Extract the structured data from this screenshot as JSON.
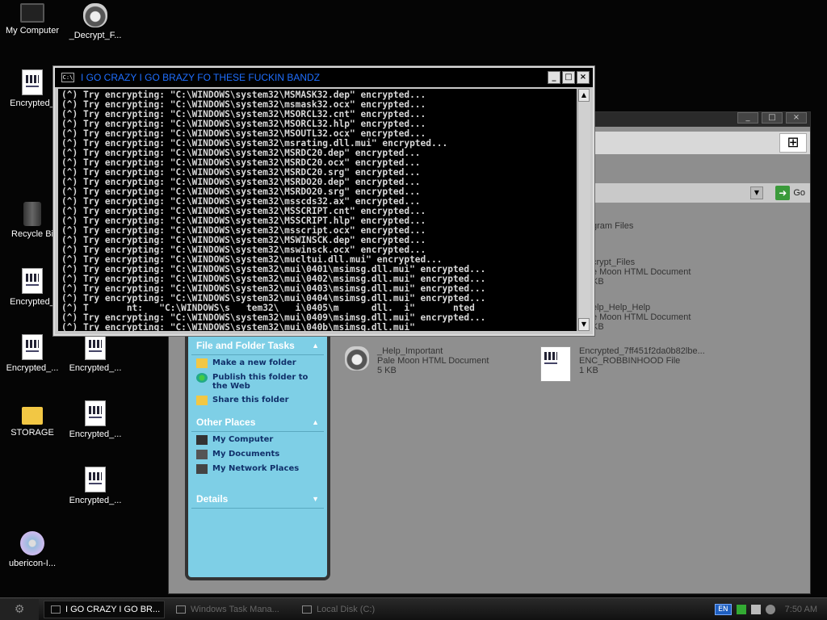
{
  "desktop": {
    "icons": [
      {
        "label": "My Computer",
        "icon": "monitor-icon"
      },
      {
        "label": "_Decrypt_F...",
        "icon": "raccoon-icon"
      },
      {
        "label": "Encrypted_",
        "icon": "document-icon"
      },
      {
        "label": "Recycle Bi",
        "icon": "recycle-bin-icon"
      },
      {
        "label": "Encrypted_",
        "icon": "document-icon"
      },
      {
        "label": "Encrypted_...",
        "icon": "document-icon"
      },
      {
        "label": "Encrypted_...",
        "icon": "document-icon"
      },
      {
        "label": "STORAGE",
        "icon": "folder-icon"
      },
      {
        "label": "Encrypted_...",
        "icon": "document-icon"
      },
      {
        "label": "Encrypted_...",
        "icon": "document-icon"
      },
      {
        "label": "ubericon-I...",
        "icon": "cd-icon"
      }
    ]
  },
  "explorer": {
    "go_label": "Go",
    "task_sections": [
      {
        "title": "File and Folder Tasks",
        "items": [
          {
            "label": "Make a new folder",
            "icon": "folder-icon"
          },
          {
            "label": "Publish this folder to the Web",
            "icon": "globe-icon"
          },
          {
            "label": "Share this folder",
            "icon": "share-folder-icon"
          }
        ]
      },
      {
        "title": "Other Places",
        "items": [
          {
            "label": "My Computer",
            "icon": "computer-icon"
          },
          {
            "label": "My Documents",
            "icon": "documents-icon"
          },
          {
            "label": "My Network Places",
            "icon": "network-icon"
          }
        ]
      },
      {
        "title": "Details",
        "items": []
      }
    ],
    "files": [
      {
        "name": "gram Files",
        "type": "",
        "size": ""
      },
      {
        "name": "crypt_Files",
        "type": "e Moon HTML Document",
        "size": "KB"
      },
      {
        "name": "elp_Help_Help",
        "type": "e Moon HTML Document",
        "size": "KB"
      },
      {
        "name": "_Help_Important",
        "type": "Pale Moon HTML Document",
        "size": "5 KB"
      },
      {
        "name": "Encrypted_7ff451f2da0b82lbe...",
        "type": "ENC_ROBBINHOOD File",
        "size": "1 KB"
      }
    ]
  },
  "console": {
    "icon_text": "C:\\",
    "title": "I GO CRAZY I GO BRAZY FO THESE FUCKIN BANDZ",
    "lines": [
      "(^) Try encrypting: \"C:\\WINDOWS\\system32\\MSMASK32.dep\" encrypted...",
      "(^) Try encrypting: \"C:\\WINDOWS\\system32\\msmask32.ocx\" encrypted...",
      "(^) Try encrypting: \"C:\\WINDOWS\\system32\\MSORCL32.cnt\" encrypted...",
      "(^) Try encrypting: \"C:\\WINDOWS\\system32\\MSORCL32.hlp\" encrypted...",
      "(^) Try encrypting: \"C:\\WINDOWS\\system32\\MSOUTL32.ocx\" encrypted...",
      "(^) Try encrypting: \"C:\\WINDOWS\\system32\\msrating.dll.mui\" encrypted...",
      "(^) Try encrypting: \"C:\\WINDOWS\\system32\\MSRDC20.dep\" encrypted...",
      "(^) Try encrypting: \"C:\\WINDOWS\\system32\\MSRDC20.ocx\" encrypted...",
      "(^) Try encrypting: \"C:\\WINDOWS\\system32\\MSRDC20.srg\" encrypted...",
      "(^) Try encrypting: \"C:\\WINDOWS\\system32\\MSRDO20.dep\" encrypted...",
      "(^) Try encrypting: \"C:\\WINDOWS\\system32\\MSRDO20.srg\" encrypted...",
      "(^) Try encrypting: \"C:\\WINDOWS\\system32\\msscds32.ax\" encrypted...",
      "(^) Try encrypting: \"C:\\WINDOWS\\system32\\MSSCRIPT.cnt\" encrypted...",
      "(^) Try encrypting: \"C:\\WINDOWS\\system32\\MSSCRIPT.hlp\" encrypted...",
      "(^) Try encrypting: \"C:\\WINDOWS\\system32\\msscript.ocx\" encrypted...",
      "(^) Try encrypting: \"C:\\WINDOWS\\system32\\MSWINSCK.dep\" encrypted...",
      "(^) Try encrypting: \"C:\\WINDOWS\\system32\\mswinsck.ocx\" encrypted...",
      "(^) Try encrypting: \"C:\\WINDOWS\\system32\\mucltui.dll.mui\" encrypted...",
      "(^) Try encrypting: \"C:\\WINDOWS\\system32\\mui\\0401\\msimsg.dll.mui\" encrypted...",
      "(^) Try encrypting: \"C:\\WINDOWS\\system32\\mui\\0402\\msimsg.dll.mui\" encrypted...",
      "(^) Try encrypting: \"C:\\WINDOWS\\system32\\mui\\0403\\msimsg.dll.mui\" encrypted...",
      "(^) Try encrypting: \"C:\\WINDOWS\\system32\\mui\\0404\\msimsg.dll.mui\" encrypted...",
      "(^) T       nt:   \"C:\\WINDOWS\\s   tem32\\   i\\0405\\m      dll.  i\"       nted",
      "(^) Try encrypting: \"C:\\WINDOWS\\system32\\mui\\0409\\msimsg.dll.mui\" encrypted...",
      "(^) Try encrypting: \"C:\\WINDOWS\\system32\\mui\\040b\\msimsg.dll.mui\""
    ]
  },
  "taskbar": {
    "tasks": [
      {
        "label": "I GO CRAZY I GO BR...",
        "active": true,
        "icon": "console-icon"
      },
      {
        "label": "Windows Task Mana...",
        "active": false,
        "icon": "task-manager-icon"
      },
      {
        "label": "Local Disk (C:)",
        "active": false,
        "icon": "drive-icon"
      }
    ],
    "language": "EN",
    "clock": "7:50 AM"
  }
}
